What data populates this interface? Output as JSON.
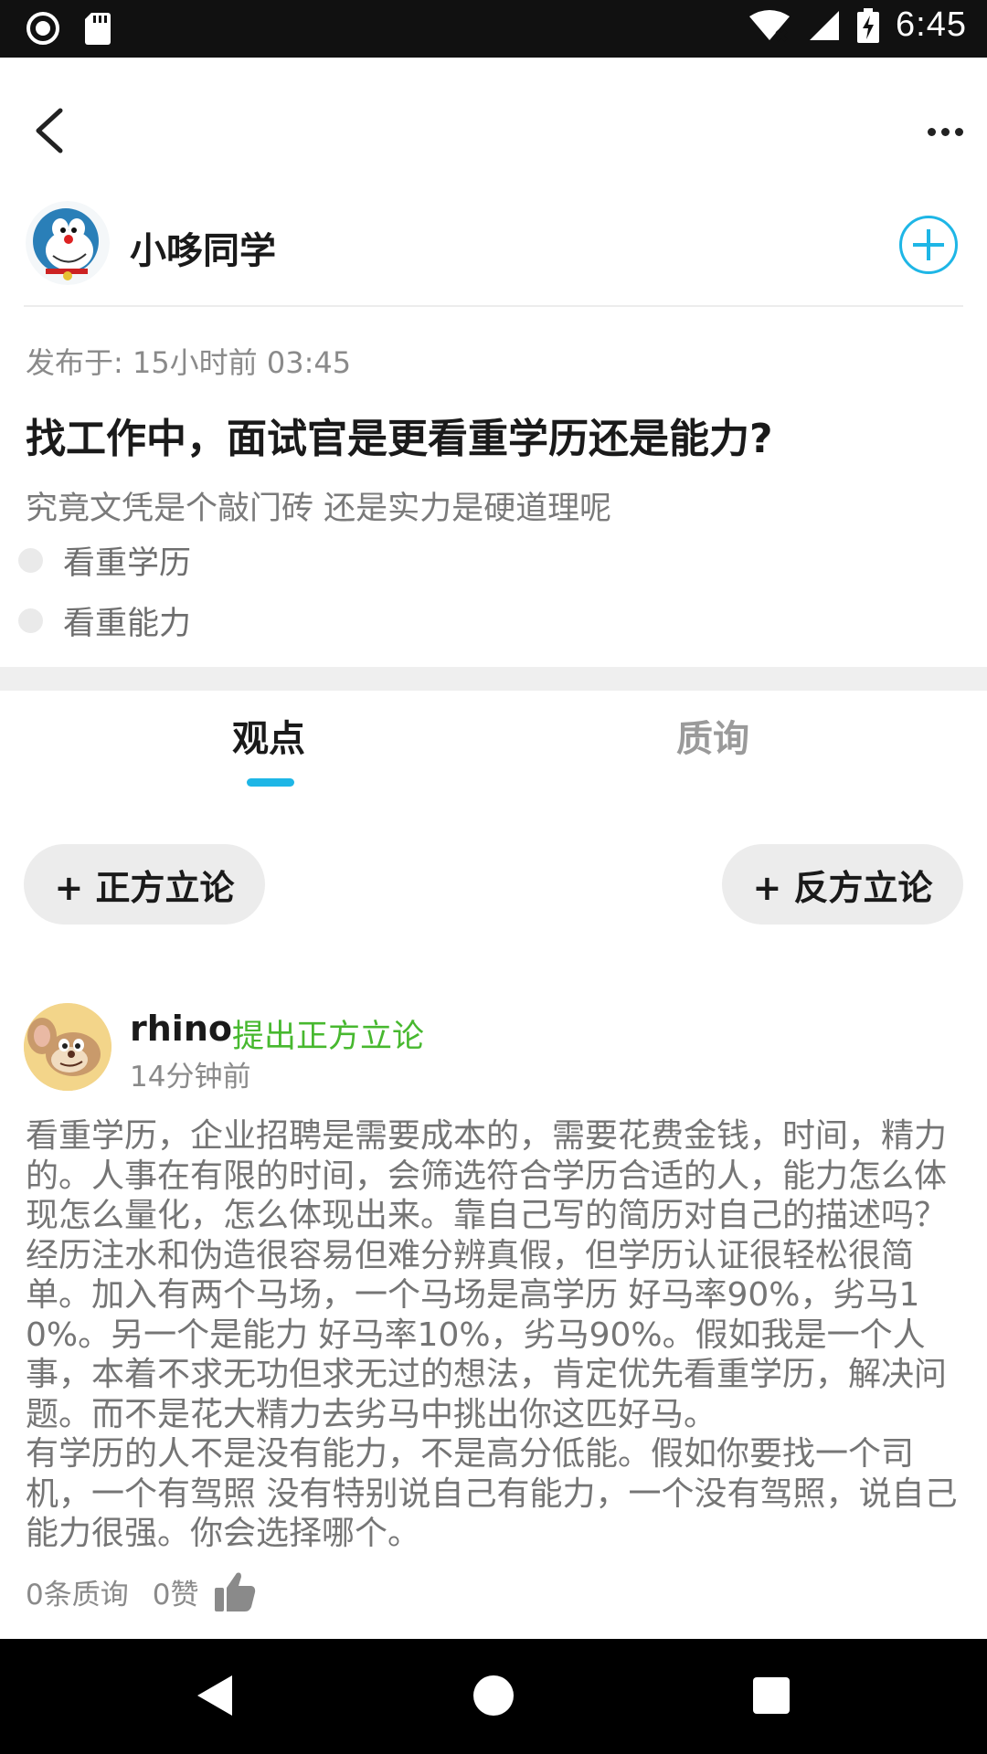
{
  "status_bar": {
    "time": "6:45",
    "icons": [
      "record-icon",
      "sd-card-icon",
      "wifi-off-icon",
      "signal-icon",
      "battery-charging-icon"
    ]
  },
  "top_nav": {
    "back_icon": "back-arrow-icon",
    "more_icon": "more-dots-icon"
  },
  "author": {
    "name": "小哆同学",
    "follow_icon": "plus-circle-icon"
  },
  "post": {
    "publish_time": "发布于: 15小时前 03:45",
    "title": "找工作中，面试官是更看重学历还是能力?",
    "subtitle": "究竟文凭是个敲门砖 还是实力是硬道理呢",
    "options": [
      "看重学历",
      "看重能力"
    ]
  },
  "tabs": [
    {
      "label": "观点",
      "active": true
    },
    {
      "label": "质询",
      "active": false
    }
  ],
  "actions": {
    "pro_label": "+ 正方立论",
    "con_label": "+ 反方立论"
  },
  "comment": {
    "username": "rhino",
    "action": "提出正方立论",
    "time": "14分钟前",
    "body": "看重学历，企业招聘是需要成本的，需要花费金钱，时间，精力的。人事在有限的时间，会筛选符合学历合适的人，能力怎么体现怎么量化，怎么体现出来。靠自己写的简历对自己的描述吗？经历注水和伪造很容易但难分辨真假，但学历认证很轻松很简单。加入有两个马场，一个马场是高学历 好马率90%，劣马10%。另一个是能力 好马率10%，劣马90%。假如我是一个人事，本着不求无功但求无过的想法，肯定优先看重学历，解决问题。而不是花大精力去劣马中挑出你这匹好马。\n有学历的人不是没有能力，不是高分低能。假如你要找一个司机，一个有驾照 没有特别说自己有能力，一个没有驾照，说自己能力很强。你会选择哪个。",
    "question_count": "0条质询",
    "likes": "0赞",
    "like_icon": "thumbs-up-icon"
  },
  "colors": {
    "accent": "#1eb6e6",
    "green": "#47b82f",
    "status_bar": "#111111"
  }
}
